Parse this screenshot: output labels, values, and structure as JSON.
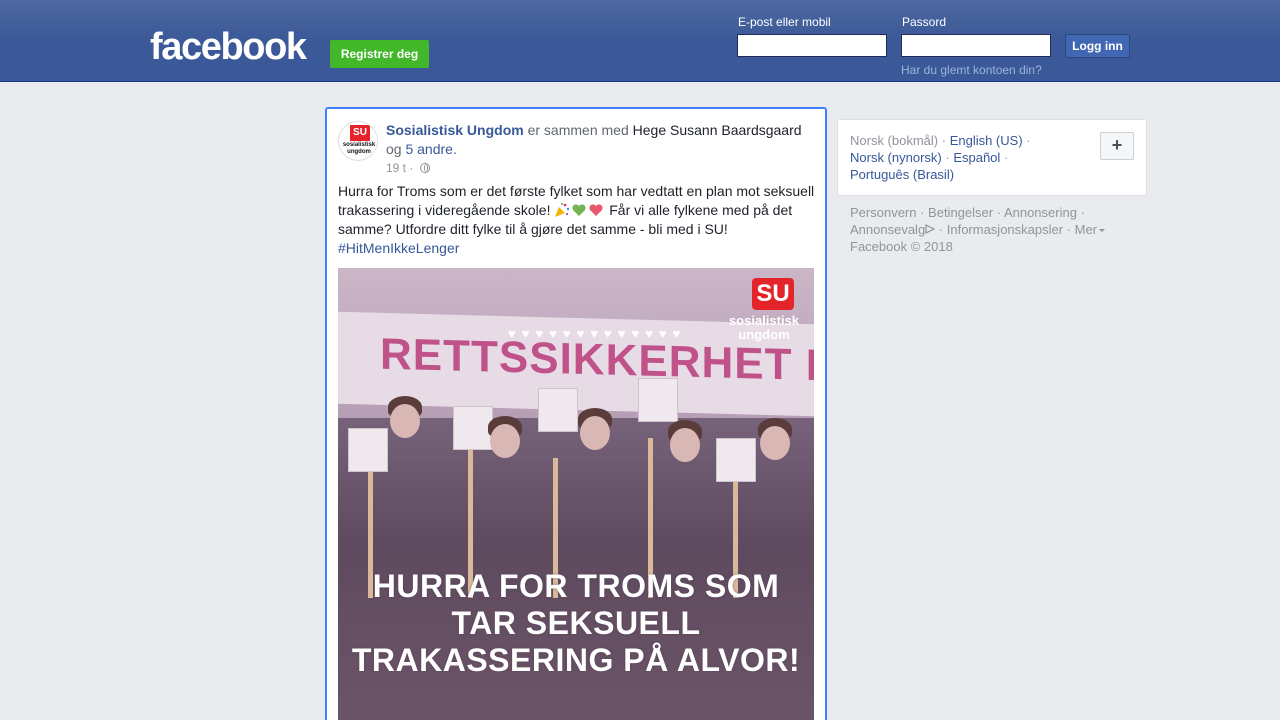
{
  "header": {
    "logo": "facebook",
    "register_label": "Registrer deg",
    "email_label": "E-post eller mobil",
    "email_value": "",
    "password_label": "Passord",
    "password_value": "",
    "login_label": "Logg inn",
    "forgot_label": "Har du glemt kontoen din?",
    "brand_color": "#3b5998"
  },
  "post": {
    "avatar_text": "SU",
    "avatar_subtext": "sosialistisk ungdom",
    "page_name": "Sosialistisk Ungdom",
    "with_text": "er sammen med",
    "tagged_person": "Hege Susann Baardsgaard",
    "and_text": "og",
    "others_link": "5 andre.",
    "time": "19 t",
    "privacy_icon": "globe-icon",
    "text_part1": "Hurra for Troms som er det første fylket som har vedtatt en plan mot seksuell trakassering i videregående skole!",
    "emojis": [
      "party-popper-icon",
      "green-heart-icon",
      "red-heart-icon"
    ],
    "text_part2": "Får vi alle fylkene med på det samme? Utfordre ditt fylke til å gjøre det samme - bli med i SU!",
    "hashtag": "#HitMenIkkeLenger",
    "image": {
      "banner_text": "RETTSSIKKERHET NÅ",
      "logo_text": "SU",
      "logo_subtext": "sosialistisk ungdom",
      "overlay_text": "HURRA FOR TROMS SOM TAR SEKSUELL TRAKASSERING PÅ ALVOR!"
    }
  },
  "sidebar": {
    "languages": [
      {
        "label": "Norsk (bokmål)",
        "current": true
      },
      {
        "label": "English (US)",
        "current": false
      },
      {
        "label": "Norsk (nynorsk)",
        "current": false
      },
      {
        "label": "Español",
        "current": false
      },
      {
        "label": "Português (Brasil)",
        "current": false
      }
    ],
    "more_languages_icon": "plus-icon",
    "footer": {
      "privacy": "Personvern",
      "terms": "Betingelser",
      "advertising": "Annonsering",
      "ad_choices": "Annonsevalg",
      "cookies": "Informasjonskapsler",
      "more": "Mer",
      "copyright": "Facebook © 2018"
    }
  }
}
